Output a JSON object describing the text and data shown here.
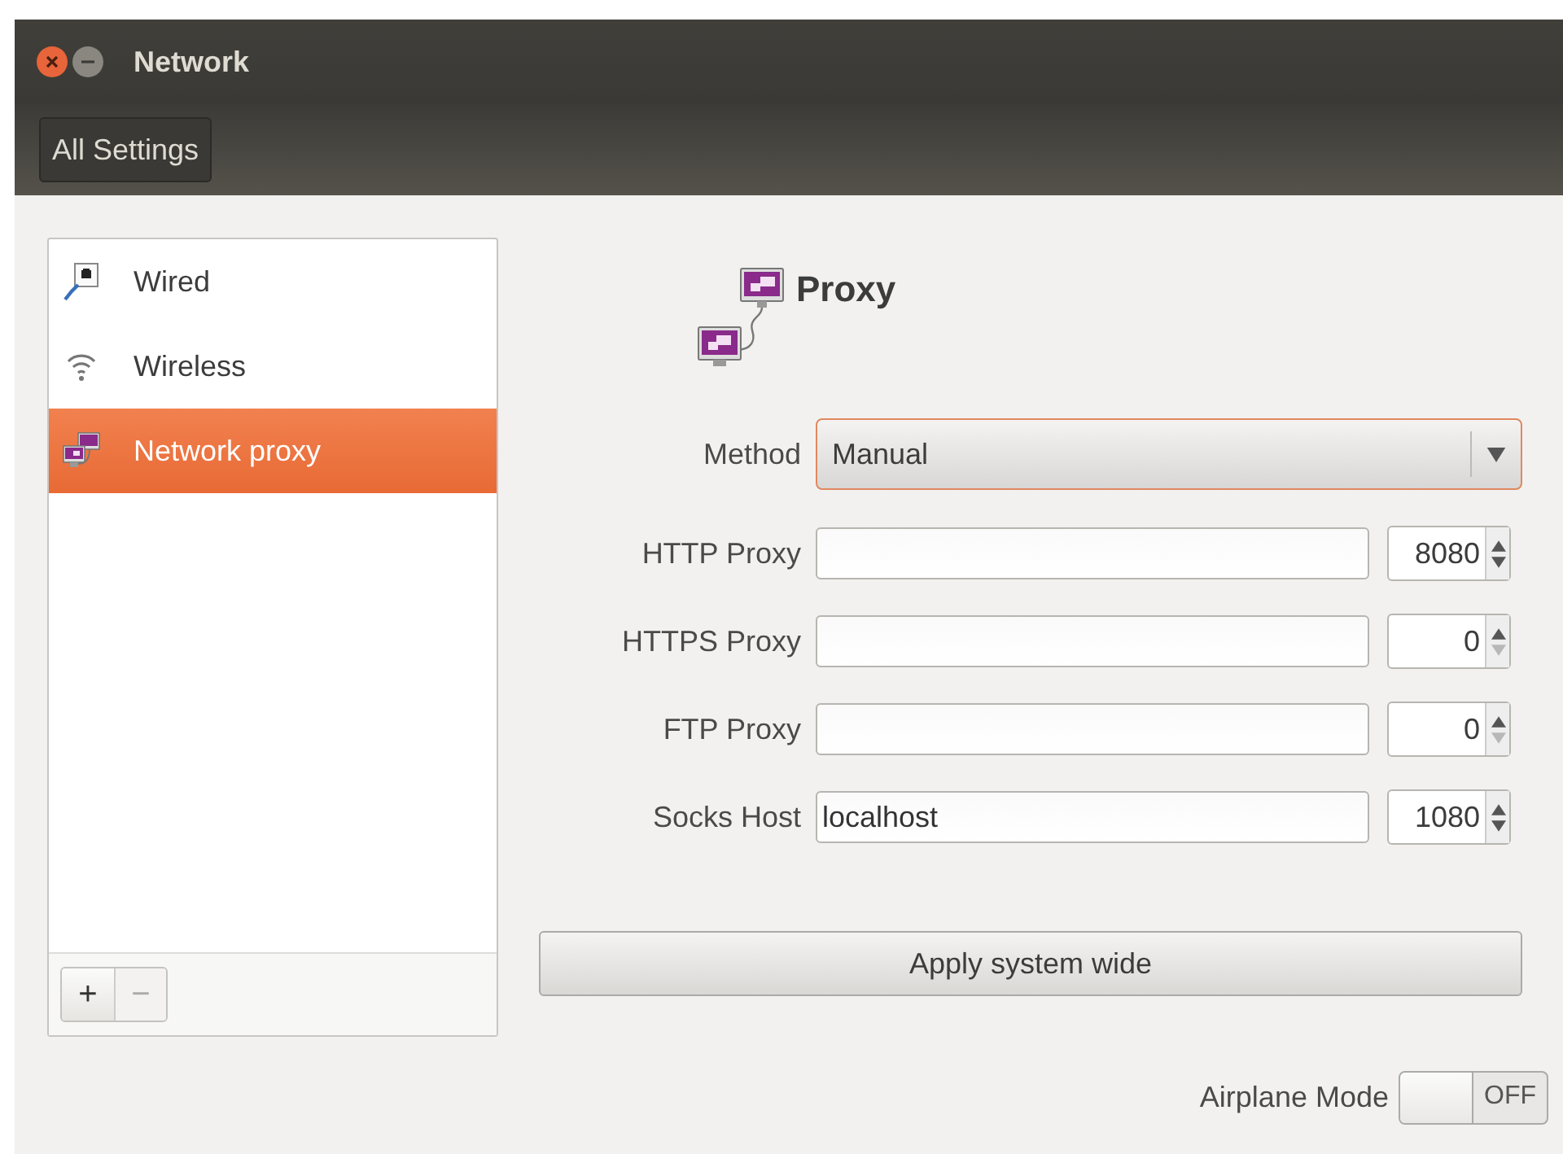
{
  "window": {
    "title": "Network"
  },
  "toolbar": {
    "back_button": "All Settings"
  },
  "sidebar": {
    "items": [
      {
        "label": "Wired",
        "kind": "wired",
        "selected": false
      },
      {
        "label": "Wireless",
        "kind": "wireless",
        "selected": false
      },
      {
        "label": "Network proxy",
        "kind": "proxy",
        "selected": true
      }
    ],
    "add_button": {
      "label": "+",
      "disabled": false
    },
    "remove_button": {
      "label": "−",
      "disabled": true
    }
  },
  "panel": {
    "title": "Proxy",
    "method": {
      "label": "Method",
      "value": "Manual"
    },
    "rows": [
      {
        "label": "HTTP Proxy",
        "value": "",
        "port": "8080",
        "down_disabled": false
      },
      {
        "label": "HTTPS Proxy",
        "value": "",
        "port": "0",
        "down_disabled": true
      },
      {
        "label": "FTP Proxy",
        "value": "",
        "port": "0",
        "down_disabled": true
      },
      {
        "label": "Socks Host",
        "value": "localhost",
        "port": "1080",
        "down_disabled": false
      }
    ],
    "apply_button": "Apply system wide"
  },
  "airplane_mode": {
    "label": "Airplane Mode",
    "on": false,
    "state_text": "OFF"
  }
}
